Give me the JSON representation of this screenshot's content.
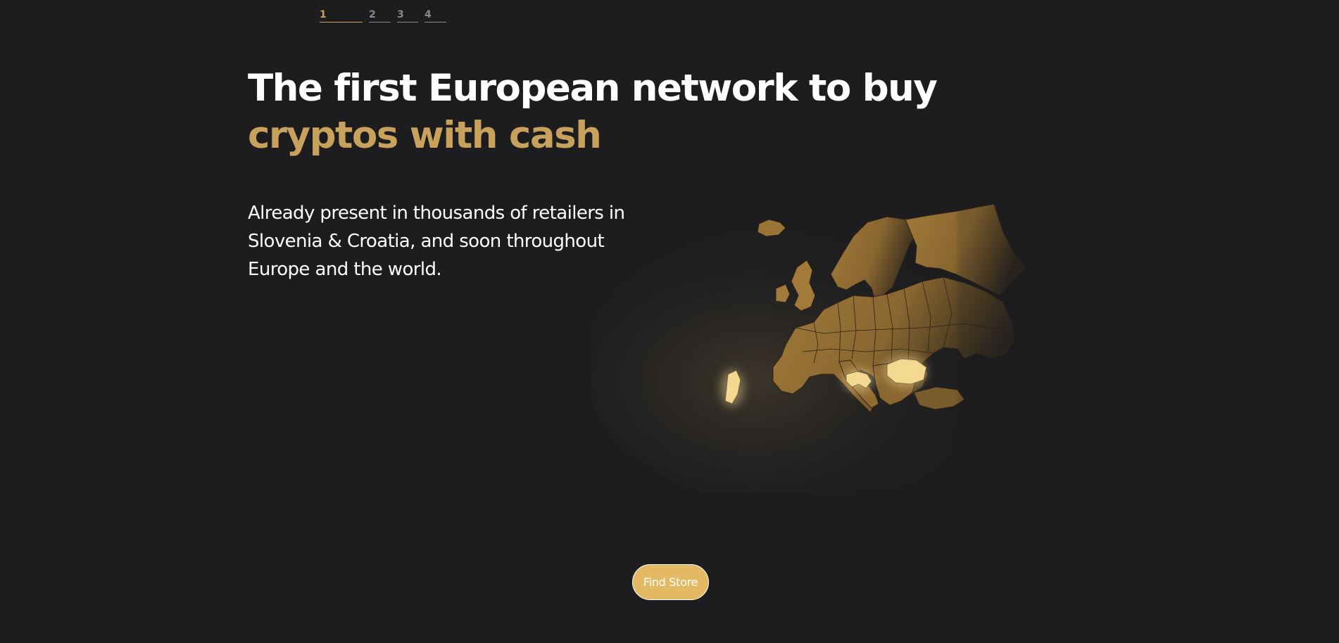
{
  "steps": [
    {
      "label": "1",
      "active": true
    },
    {
      "label": "2",
      "active": false
    },
    {
      "label": "3",
      "active": false
    },
    {
      "label": "4",
      "active": false
    }
  ],
  "hero": {
    "headline_line1": "The first European network to buy",
    "headline_line2": "cryptos with cash",
    "subtext": "Already present in thousands of retailers in Slovenia & Croatia, and soon throughout Europe and the world."
  },
  "map": {
    "highlighted_regions": [
      "Portugal",
      "Slovenia",
      "Croatia",
      "Romania"
    ],
    "base_color": "#8c6a34",
    "highlight_color": "#f3d68e"
  },
  "cta": {
    "label": "Find Store"
  },
  "colors": {
    "background": "#1d1d1f",
    "accent": "#c8a25c",
    "button": "#e3b964"
  }
}
